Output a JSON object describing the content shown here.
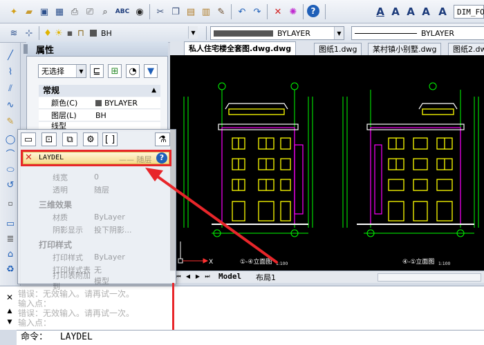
{
  "toolbar_top": {
    "icons": [
      "new-file-icon",
      "open-folder-icon",
      "save-icon",
      "save-as-icon",
      "print-icon",
      "print-preview-icon",
      "find-icon",
      "spellcheck-icon",
      "binoculars-icon",
      "cut-icon",
      "copy-icon",
      "paste-icon",
      "paste-special-icon",
      "match-properties-icon",
      "undo-icon",
      "redo-icon",
      "delete-icon",
      "purge-icon",
      "help-icon",
      "text-style-icon",
      "text-icon",
      "text-edit-icon",
      "text-scale-icon"
    ],
    "spell_label": "ABC",
    "dim_style": "DIM_FO"
  },
  "toolbar_layers": {
    "layer_name": "BH",
    "color_value": "BYLAYER",
    "linetype_value": "BYLAYER"
  },
  "properties_panel": {
    "title": "属性",
    "selection": "无选择",
    "section_general": "常规",
    "rows": [
      {
        "label": "颜色(C)",
        "value": "BYLAYER"
      },
      {
        "label": "图层(L)",
        "value": "BH"
      },
      {
        "label": "线型",
        "value": ""
      }
    ]
  },
  "doc_tabs": [
    {
      "label": "私人住宅楼全套图.dwg.dwg",
      "active": true
    },
    {
      "label": "图纸1.dwg",
      "active": false
    },
    {
      "label": "某村镇小别墅.dwg",
      "active": false
    },
    {
      "label": "图纸2.dw",
      "active": false
    }
  ],
  "drawing_labels": {
    "left_title": "①-④立面图",
    "left_scale": "1:100",
    "right_title": "④-①立面图",
    "right_scale": "1:100",
    "axis_x": "X",
    "axis_y": "Y"
  },
  "layout_tabs": [
    "Model",
    "布局1"
  ],
  "popup": {
    "item_label": "LAYDEL",
    "faded_rows": [
      {
        "label": "线型",
        "value": "—— 随层"
      },
      {
        "label": "线宽",
        "value": "0"
      },
      {
        "label": "透明",
        "value": "随层"
      }
    ],
    "section_3d": "三维效果",
    "rows_3d": [
      {
        "label": "材质",
        "value": "ByLayer"
      },
      {
        "label": "阴影显示",
        "value": "投下阴影..."
      }
    ],
    "section_print": "打印样式",
    "rows_print": [
      {
        "label": "打印样式",
        "value": "ByLayer"
      },
      {
        "label": "打印样式表",
        "value": "无"
      },
      {
        "label": "打印表附加到",
        "value": "模型"
      }
    ]
  },
  "command_history": [
    "错误：无效输入。请再试一次。",
    "输入点：",
    "错误：无效输入。请再试一次。",
    "输入点："
  ],
  "command_line": {
    "prompt": "命令：",
    "value": "LAYDEL"
  },
  "colors": {
    "annotation_red": "#e8262a",
    "drawing_background": "#000000",
    "building_magenta": "#ff00ff",
    "window_yellow": "#ffff00",
    "grid_green": "#00ff00",
    "dim_white": "#ffffff"
  }
}
